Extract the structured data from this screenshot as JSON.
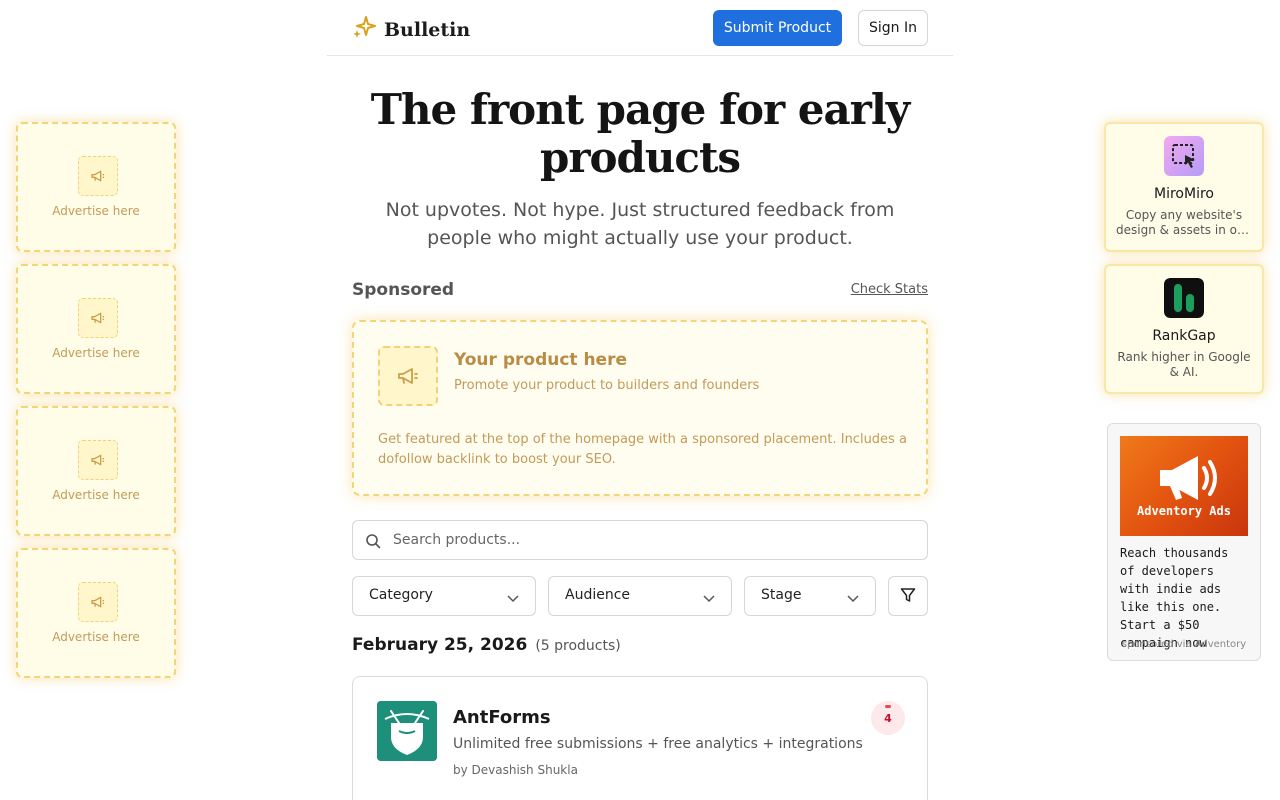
{
  "header": {
    "brand": "Bulletin",
    "submit_label": "Submit Product",
    "signin_label": "Sign In"
  },
  "hero": {
    "title": "The front page for early products",
    "subtitle": "Not upvotes. Not hype. Just structured feedback from people who might actually use your product."
  },
  "sponsored": {
    "label": "Sponsored",
    "check_stats": "Check Stats",
    "card": {
      "title": "Your product here",
      "description": "Promote your product to builders and founders",
      "body": "Get featured at the top of the homepage with a sponsored placement. Includes a dofollow backlink to boost your SEO."
    }
  },
  "search": {
    "placeholder": "Search products..."
  },
  "filters": {
    "category": "Category",
    "audience": "Audience",
    "stage": "Stage"
  },
  "listing": {
    "date": "February 25, 2026",
    "count": "(5 products)"
  },
  "product": {
    "name": "AntForms",
    "tagline": "Unlimited free submissions + free analytics + integrations",
    "author": "by Devashish Shukla",
    "score": "4"
  },
  "left_ads": [
    {
      "label": "Advertise here"
    },
    {
      "label": "Advertise here"
    },
    {
      "label": "Advertise here"
    },
    {
      "label": "Advertise here"
    }
  ],
  "right_sponsors": [
    {
      "name": "MiroMiro",
      "description": "Copy any website's design & assets in one click"
    },
    {
      "name": "RankGap",
      "description": "Rank higher in Google & AI."
    }
  ],
  "adventory": {
    "title": "Adventory Ads",
    "text": "Reach thousands of developers with indie ads like this one. Start a $50 campaign now",
    "via": "sponsored via Adventory"
  },
  "colors": {
    "primary": "#1f6fde",
    "gold": "#f2d57a",
    "gold_text": "#c29b5a",
    "antforms_green": "#1e8f7a",
    "adventory_orange": "#e35410"
  }
}
